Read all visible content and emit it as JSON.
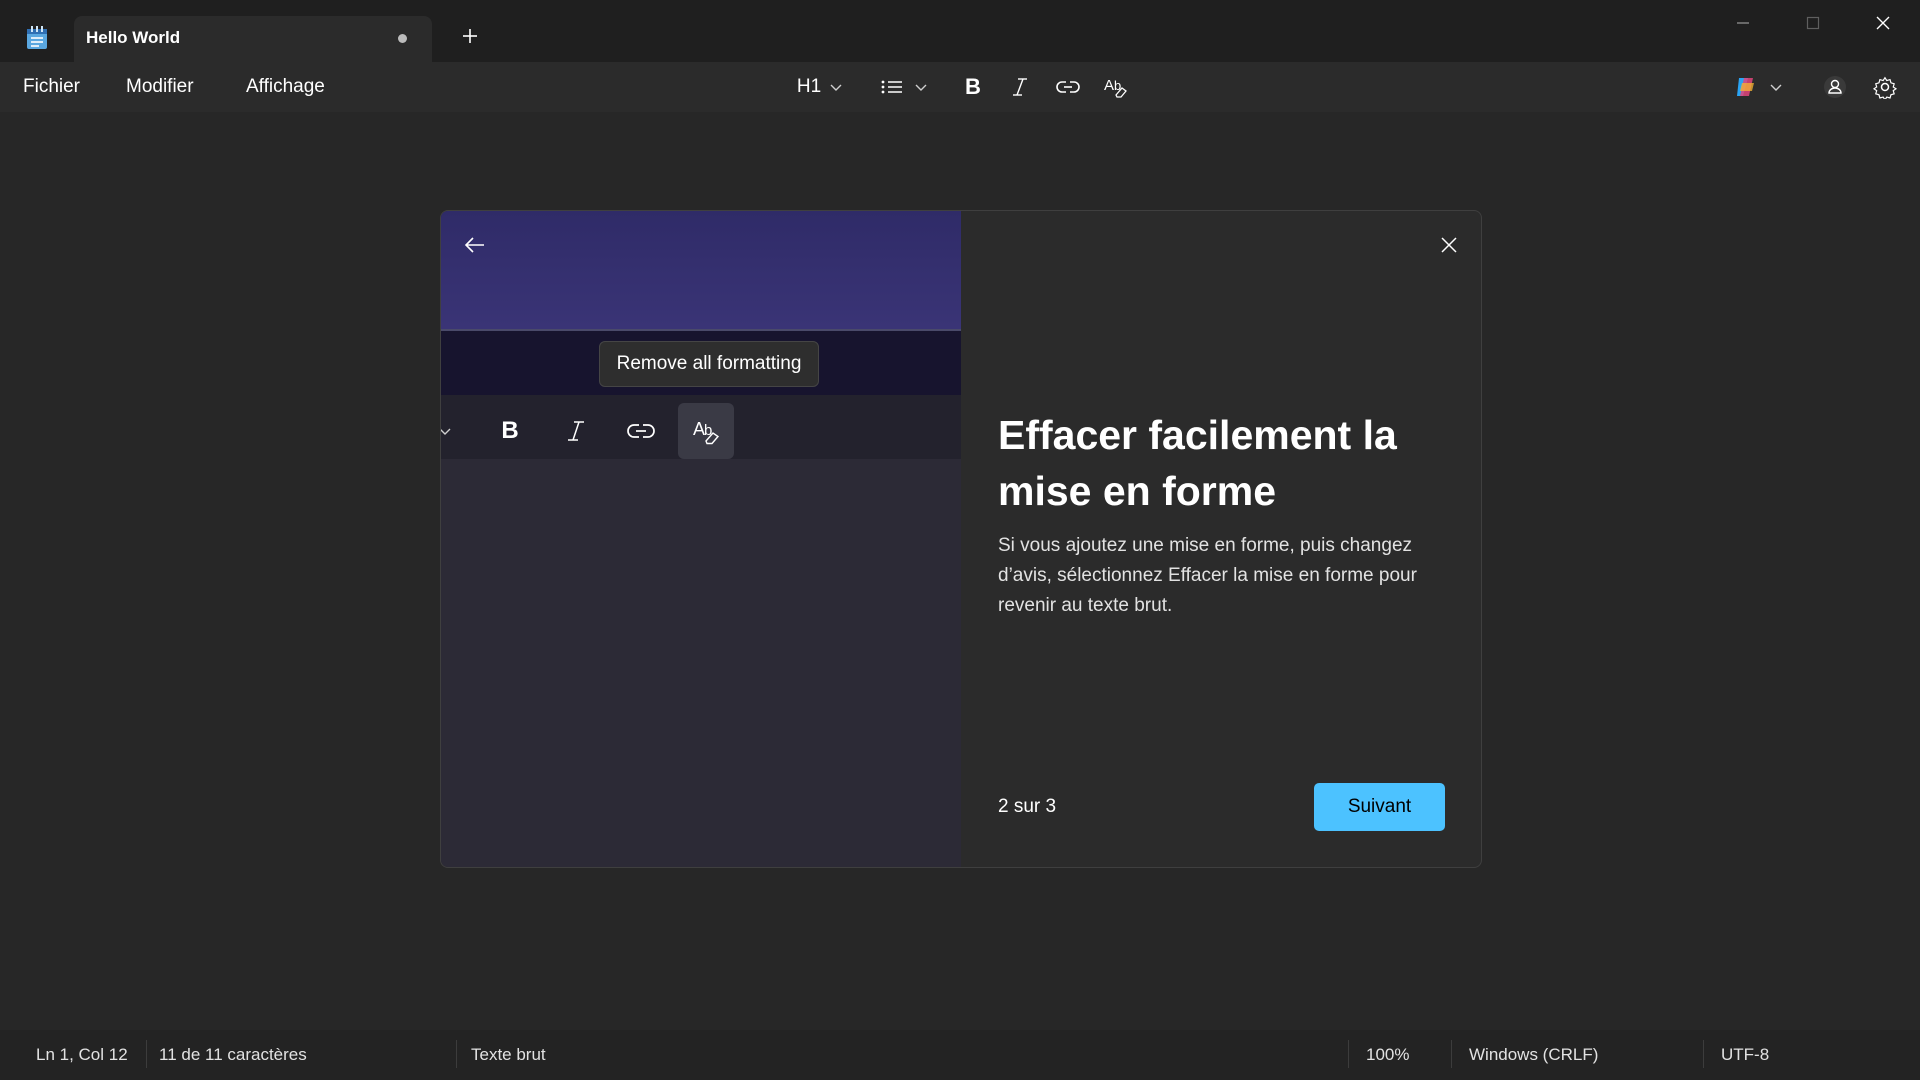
{
  "window": {
    "tab_title": "Hello World",
    "tab_modified": true
  },
  "menu": {
    "items": [
      "Fichier",
      "Modifier",
      "Affichage"
    ]
  },
  "toolbar": {
    "heading_label": "H1",
    "icons": [
      "list-icon",
      "bold-icon",
      "italic-icon",
      "link-icon",
      "clear-formatting-icon",
      "copilot-icon",
      "account-icon",
      "settings-icon"
    ]
  },
  "dialog": {
    "tooltip": "Remove all formatting",
    "title": "Effacer facilement la mise en forme",
    "body": "Si vous ajoutez une mise en forme, puis changez d’avis, sélectionnez Effacer la mise en forme pour revenir au texte brut.",
    "step": "2 sur 3",
    "next_label": "Suivant"
  },
  "status": {
    "position": "Ln 1, Col 12",
    "chars": "11 de 11 caractères",
    "mode": "Texte brut",
    "zoom": "100%",
    "line_endings": "Windows (CRLF)",
    "encoding": "UTF-8"
  },
  "colors": {
    "accent": "#4cc2ff",
    "background": "#272727"
  }
}
